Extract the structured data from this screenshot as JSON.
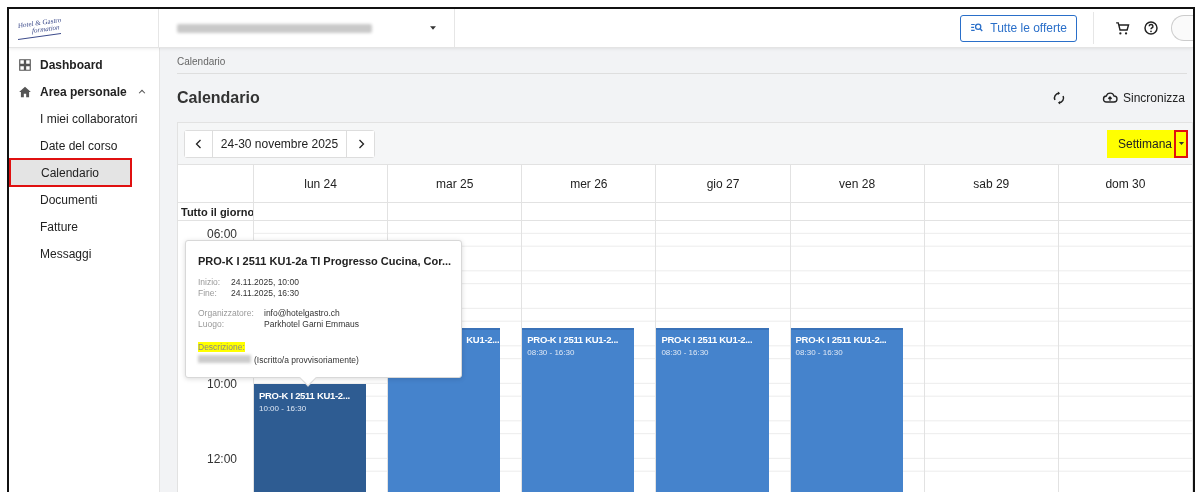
{
  "header": {
    "logo": {
      "line_1": "Hotel & Gastro",
      "line_2": "formation"
    },
    "offers_button": "Tutte le offerte"
  },
  "sidebar": {
    "items": [
      {
        "label": "Dashboard",
        "kind": "top",
        "selected": false,
        "highlighted": false
      },
      {
        "label": "Area personale",
        "kind": "group",
        "expanded": true,
        "selected": false,
        "highlighted": false,
        "children": [
          {
            "label": "I miei collaboratori",
            "selected": false,
            "highlighted": false
          },
          {
            "label": "Date del corso",
            "selected": false,
            "highlighted": false
          },
          {
            "label": "Calendario",
            "selected": true,
            "highlighted": true
          },
          {
            "label": "Documenti",
            "selected": false,
            "highlighted": false
          },
          {
            "label": "Fatture",
            "selected": false,
            "highlighted": false
          },
          {
            "label": "Messaggi",
            "selected": false,
            "highlighted": false
          }
        ]
      }
    ]
  },
  "breadcrumb": "Calendario",
  "page_title": "Calendario",
  "sync_button": "Sincronizza",
  "calendar": {
    "range": "24-30 novembre 2025",
    "view": {
      "label": "Settimana",
      "highlighted": true,
      "caret_outlined": true
    },
    "all_day_label": "Tutto il giorno",
    "time_labels": [
      "06:00",
      "10:00",
      "12:00"
    ],
    "days": [
      {
        "label": "lun 24",
        "events": [
          {
            "title": "PRO-K I 2511 KU1-2...",
            "time": "10:00 - 16:30",
            "selected": true,
            "covered": false
          }
        ]
      },
      {
        "label": "mar 25",
        "events": [
          {
            "title": "KU1-2...",
            "selected": false,
            "covered": true
          }
        ]
      },
      {
        "label": "mer 26",
        "events": [
          {
            "title": "PRO-K I 2511 KU1-2...",
            "time": "08:30 - 16:30",
            "selected": false,
            "covered": false
          }
        ]
      },
      {
        "label": "gio 27",
        "events": [
          {
            "title": "PRO-K I 2511 KU1-2...",
            "time": "08:30 - 16:30",
            "selected": false,
            "covered": false
          }
        ]
      },
      {
        "label": "ven 28",
        "events": [
          {
            "title": "PRO-K I 2511 KU1-2...",
            "time": "08:30 - 16:30",
            "selected": false,
            "covered": false
          }
        ]
      },
      {
        "label": "sab 29"
      },
      {
        "label": "dom 30"
      }
    ],
    "popover": {
      "title": "PRO-K I 2511 KU1-2a TI Progresso Cucina, Cor...",
      "times": [
        {
          "label": "Inizio:",
          "value": "24.11.2025, 10:00"
        },
        {
          "label": "Fine:",
          "value": "24.11.2025, 16:30"
        }
      ],
      "details": [
        {
          "label": "Organizzatore:",
          "value": "info@hotelgastro.ch"
        },
        {
          "label": "Luogo:",
          "value": "Parkhotel Garni Emmaus"
        }
      ],
      "description_label": {
        "text": "Descrizione:",
        "highlighted": true
      },
      "description": "(Iscritto/a provvisoriamente)"
    }
  }
}
